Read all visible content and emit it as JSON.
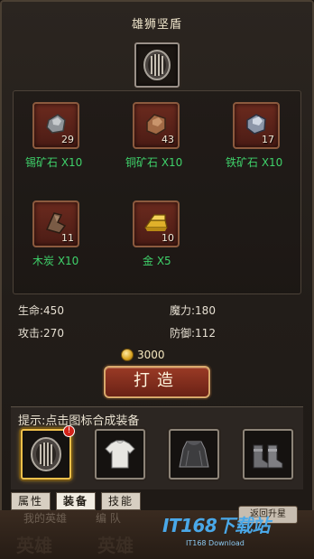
{
  "item_name": "雄狮坚盾",
  "materials": [
    {
      "label": "锡矿石 X10",
      "count": "29",
      "icon": "ore-gray-icon"
    },
    {
      "label": "铜矿石 X10",
      "count": "43",
      "icon": "ore-copper-icon"
    },
    {
      "label": "铁矿石 X10",
      "count": "17",
      "icon": "ore-iron-icon"
    },
    {
      "label": "木炭 X10",
      "count": "11",
      "icon": "charcoal-icon"
    },
    {
      "label": "金 X5",
      "count": "10",
      "icon": "gold-bar-icon"
    }
  ],
  "stats": {
    "hp": "生命:450",
    "mp": "魔力:180",
    "atk": "攻击:270",
    "def": "防御:112"
  },
  "cost": "3000",
  "forge_button": "打造",
  "hint": "提示:点击图标合成装备",
  "equipment": [
    {
      "name": "shield",
      "icon": "shield-icon",
      "badge": "!"
    },
    {
      "name": "shirt",
      "icon": "shirt-icon",
      "badge": ""
    },
    {
      "name": "cloak",
      "icon": "cloak-icon",
      "badge": ""
    },
    {
      "name": "boots",
      "icon": "boots-icon",
      "badge": ""
    }
  ],
  "tabs": [
    "属性",
    "装备",
    "技能"
  ],
  "background_nav": {
    "my_hero": "我的英雄",
    "formation": "编  队",
    "return_upgrade": "返回升星",
    "big_left": "英雄",
    "big_mid": "英雄"
  },
  "watermark": {
    "main": "IT168下载站",
    "sub": "IT168 Download"
  },
  "colors": {
    "material_label": "#3fd16a",
    "slot_bg": "#5a2218",
    "accent_gold": "#f0c04a"
  }
}
